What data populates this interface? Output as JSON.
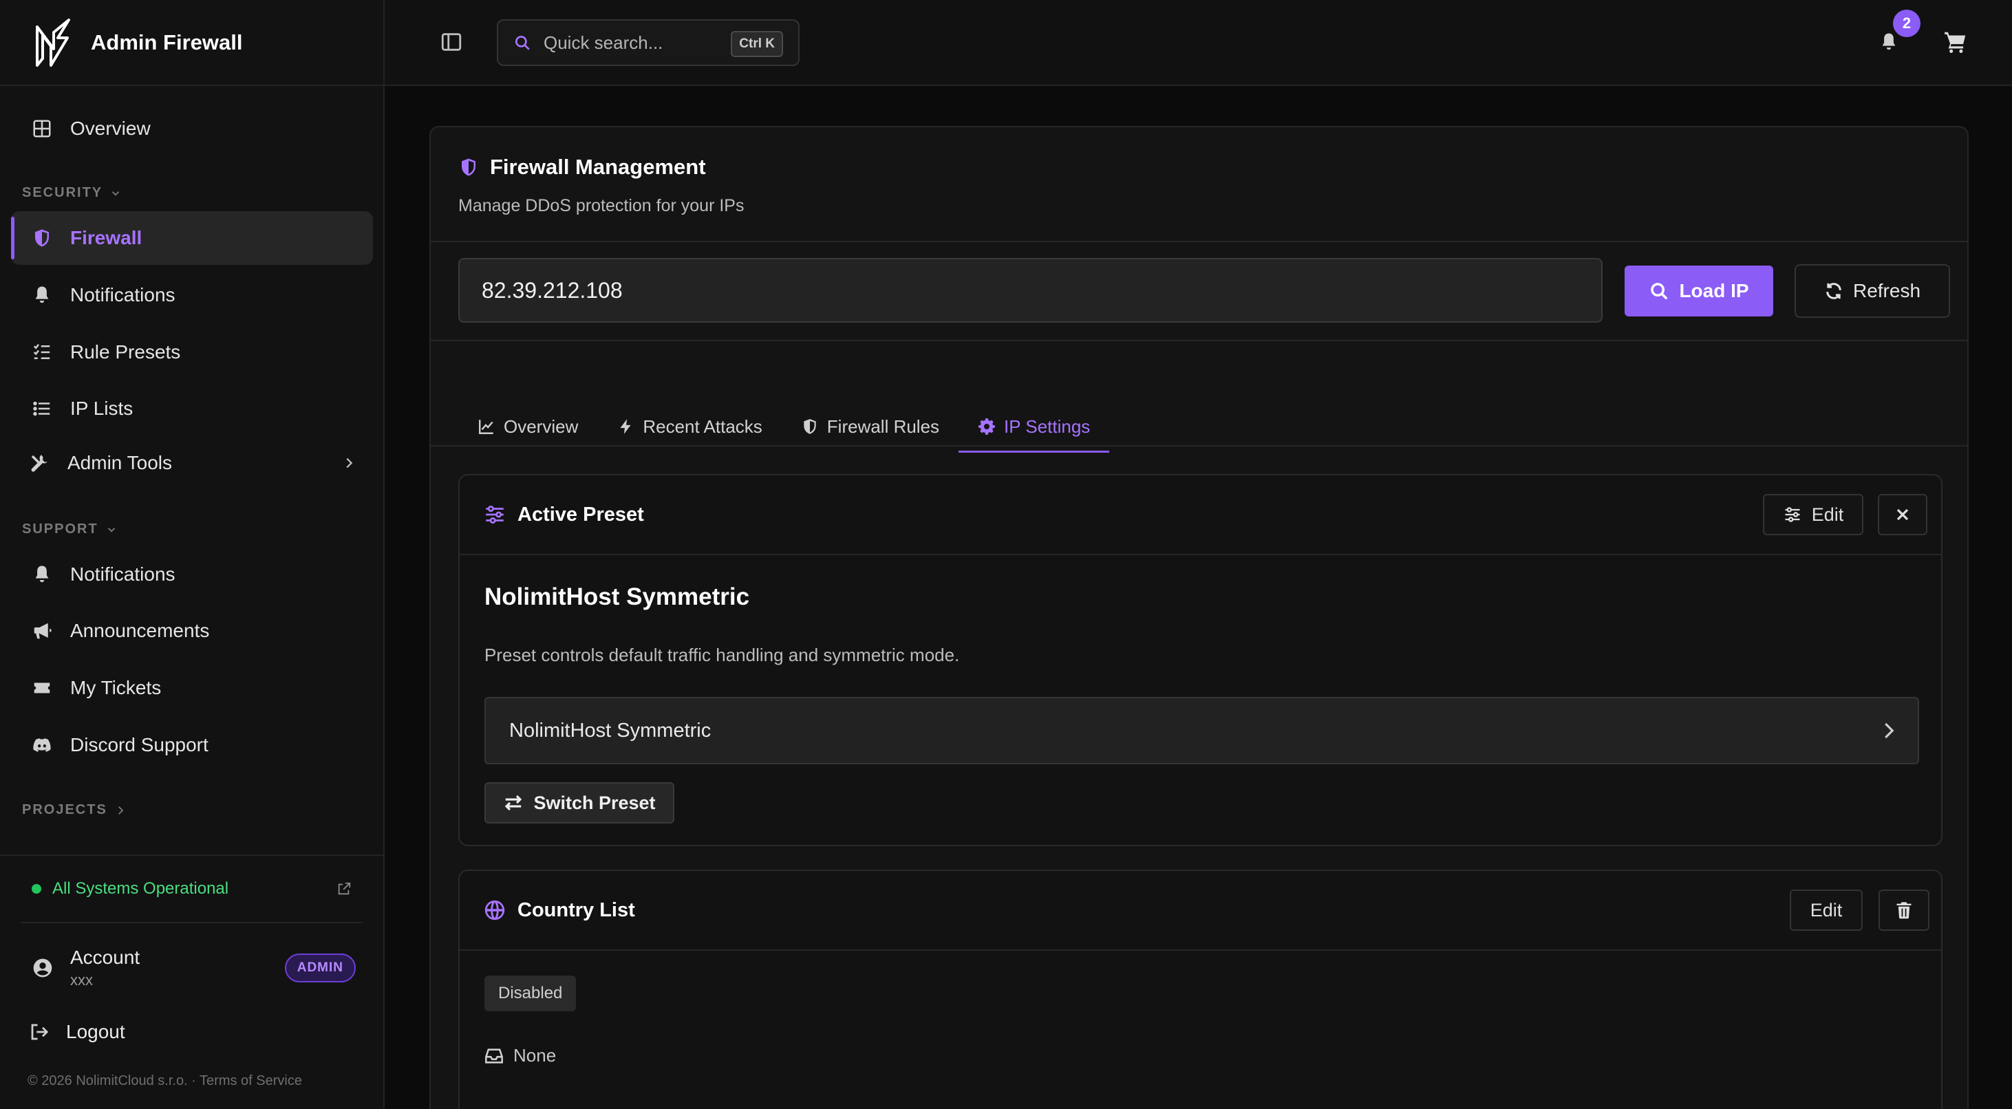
{
  "brand": {
    "title": "Admin Firewall"
  },
  "sidebar": {
    "overview": "Overview",
    "security_label": "SECURITY",
    "security_items": [
      {
        "label": "Firewall",
        "icon": "shield-icon",
        "active": true
      },
      {
        "label": "Notifications",
        "icon": "bell-icon"
      },
      {
        "label": "Rule Presets",
        "icon": "list-check-icon"
      },
      {
        "label": "IP Lists",
        "icon": "list-icon"
      },
      {
        "label": "Admin Tools",
        "icon": "tools-icon"
      }
    ],
    "support_label": "SUPPORT",
    "support_items": [
      {
        "label": "Notifications",
        "icon": "bell-icon"
      },
      {
        "label": "Announcements",
        "icon": "megaphone-icon"
      },
      {
        "label": "My Tickets",
        "icon": "ticket-icon"
      },
      {
        "label": "Discord Support",
        "icon": "discord-icon"
      }
    ],
    "projects_label": "PROJECTS",
    "status": "All Systems Operational",
    "account": {
      "name": "Account",
      "sub": "xxx",
      "badge": "ADMIN"
    },
    "logout": "Logout",
    "footer": "© 2026 NolimitCloud s.r.o.  ·  Terms of Service"
  },
  "topbar": {
    "search_placeholder": "Quick search...",
    "search_shortcut": "Ctrl K",
    "notification_count": "2"
  },
  "firewall": {
    "title": "Firewall Management",
    "subtitle": "Manage DDoS protection for your IPs",
    "ip_value": "82.39.212.108",
    "load_label": "Load IP",
    "refresh_label": "Refresh",
    "tabs": [
      {
        "label": "Overview",
        "icon": "chart-line-icon"
      },
      {
        "label": "Recent Attacks",
        "icon": "bolt-icon"
      },
      {
        "label": "Firewall Rules",
        "icon": "shield-icon"
      },
      {
        "label": "IP Settings",
        "icon": "gear-icon",
        "active": true
      }
    ]
  },
  "active_preset": {
    "title": "Active Preset",
    "edit_label": "Edit",
    "preset_name": "NolimitHost Symmetric",
    "description": "Preset controls default traffic handling and symmetric mode.",
    "selected": "NolimitHost Symmetric",
    "switch_label": "Switch Preset"
  },
  "country_list": {
    "title": "Country List",
    "edit_label": "Edit",
    "status": "Disabled",
    "value": "None"
  },
  "colors": {
    "accent": "#8b5cf6",
    "accent_text": "#a773ff",
    "status_green": "#22c55e"
  }
}
